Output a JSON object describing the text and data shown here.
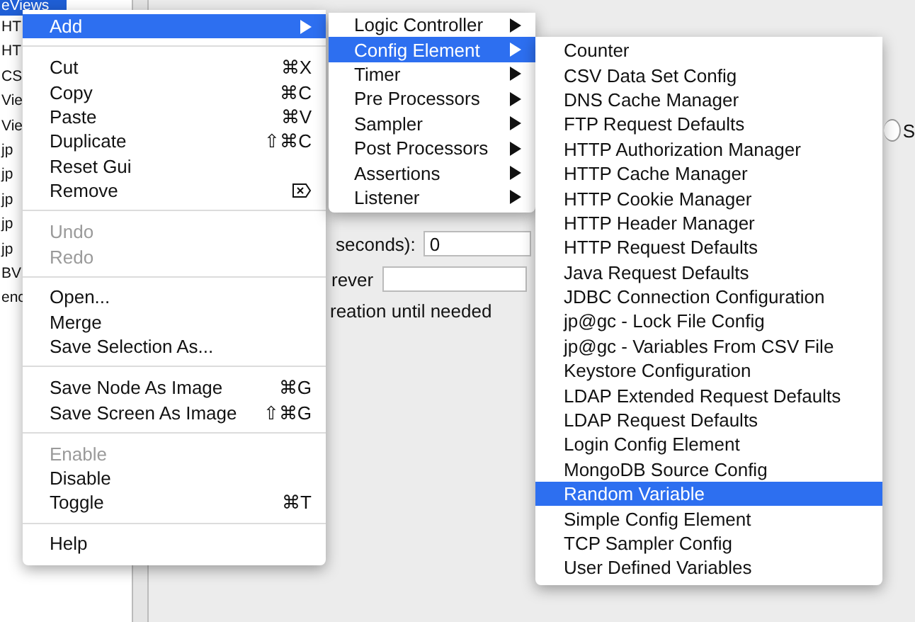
{
  "tree": {
    "items": [
      {
        "label": "eViews",
        "selected": true
      },
      {
        "label": "HT",
        "selected": false
      },
      {
        "label": "HT",
        "selected": false
      },
      {
        "label": "CS",
        "selected": false
      },
      {
        "label": "Vie",
        "selected": false
      },
      {
        "label": "Vie",
        "selected": false
      },
      {
        "label": "jp",
        "selected": false
      },
      {
        "label": "jp",
        "selected": false
      },
      {
        "label": "jp",
        "selected": false
      },
      {
        "label": "jp",
        "selected": false
      },
      {
        "label": "jp",
        "selected": false
      },
      {
        "label": "BV",
        "selected": false
      },
      {
        "label": "enc",
        "selected": false
      }
    ]
  },
  "panel": {
    "radio_selected": false,
    "radio_label": "S",
    "seconds_label": "seconds):",
    "seconds_value": "0",
    "forever_label": "rever",
    "delay_text": "reation until needed"
  },
  "context_menu": {
    "items": [
      {
        "kind": "item",
        "label": "Add",
        "submenu": true,
        "selected": true,
        "disabled": false
      },
      {
        "kind": "separator"
      },
      {
        "kind": "item",
        "label": "Cut",
        "shortcut": "⌘X",
        "selected": false,
        "disabled": false
      },
      {
        "kind": "item",
        "label": "Copy",
        "shortcut": "⌘C",
        "selected": false,
        "disabled": false
      },
      {
        "kind": "item",
        "label": "Paste",
        "shortcut": "⌘V",
        "selected": false,
        "disabled": false
      },
      {
        "kind": "item",
        "label": "Duplicate",
        "shortcut": "⇧⌘C",
        "selected": false,
        "disabled": false
      },
      {
        "kind": "item",
        "label": "Reset Gui",
        "selected": false,
        "disabled": false
      },
      {
        "kind": "item",
        "label": "Remove",
        "delete_key_icon": true,
        "selected": false,
        "disabled": false
      },
      {
        "kind": "separator"
      },
      {
        "kind": "item",
        "label": "Undo",
        "selected": false,
        "disabled": true
      },
      {
        "kind": "item",
        "label": "Redo",
        "selected": false,
        "disabled": true
      },
      {
        "kind": "separator"
      },
      {
        "kind": "item",
        "label": "Open...",
        "selected": false,
        "disabled": false
      },
      {
        "kind": "item",
        "label": "Merge",
        "selected": false,
        "disabled": false
      },
      {
        "kind": "item",
        "label": "Save Selection As...",
        "selected": false,
        "disabled": false
      },
      {
        "kind": "separator"
      },
      {
        "kind": "item",
        "label": "Save Node As Image",
        "shortcut": "⌘G",
        "selected": false,
        "disabled": false
      },
      {
        "kind": "item",
        "label": "Save Screen As Image",
        "shortcut": "⇧⌘G",
        "selected": false,
        "disabled": false
      },
      {
        "kind": "separator"
      },
      {
        "kind": "item",
        "label": "Enable",
        "selected": false,
        "disabled": true
      },
      {
        "kind": "item",
        "label": "Disable",
        "selected": false,
        "disabled": false
      },
      {
        "kind": "item",
        "label": "Toggle",
        "shortcut": "⌘T",
        "selected": false,
        "disabled": false
      },
      {
        "kind": "separator"
      },
      {
        "kind": "item",
        "label": "Help",
        "selected": false,
        "disabled": false
      }
    ]
  },
  "add_submenu": {
    "items": [
      {
        "label": "Logic Controller",
        "selected": false
      },
      {
        "label": "Config Element",
        "selected": true
      },
      {
        "label": "Timer",
        "selected": false
      },
      {
        "label": "Pre Processors",
        "selected": false
      },
      {
        "label": "Sampler",
        "selected": false
      },
      {
        "label": "Post Processors",
        "selected": false
      },
      {
        "label": "Assertions",
        "selected": false
      },
      {
        "label": "Listener",
        "selected": false
      }
    ]
  },
  "config_submenu": {
    "items": [
      {
        "label": "Counter",
        "selected": false
      },
      {
        "label": "CSV Data Set Config",
        "selected": false
      },
      {
        "label": "DNS Cache Manager",
        "selected": false
      },
      {
        "label": "FTP Request Defaults",
        "selected": false
      },
      {
        "label": "HTTP Authorization Manager",
        "selected": false
      },
      {
        "label": "HTTP Cache Manager",
        "selected": false
      },
      {
        "label": "HTTP Cookie Manager",
        "selected": false
      },
      {
        "label": "HTTP Header Manager",
        "selected": false
      },
      {
        "label": "HTTP Request Defaults",
        "selected": false
      },
      {
        "label": "Java Request Defaults",
        "selected": false
      },
      {
        "label": "JDBC Connection Configuration",
        "selected": false
      },
      {
        "label": "jp@gc - Lock File Config",
        "selected": false
      },
      {
        "label": "jp@gc - Variables From CSV File",
        "selected": false
      },
      {
        "label": "Keystore Configuration",
        "selected": false
      },
      {
        "label": "LDAP Extended Request Defaults",
        "selected": false
      },
      {
        "label": "LDAP Request Defaults",
        "selected": false
      },
      {
        "label": "Login Config Element",
        "selected": false
      },
      {
        "label": "MongoDB Source Config",
        "selected": false
      },
      {
        "label": "Random Variable",
        "selected": true
      },
      {
        "label": "Simple Config Element",
        "selected": false
      },
      {
        "label": "TCP Sampler Config",
        "selected": false
      },
      {
        "label": "User Defined Variables",
        "selected": false
      }
    ]
  }
}
